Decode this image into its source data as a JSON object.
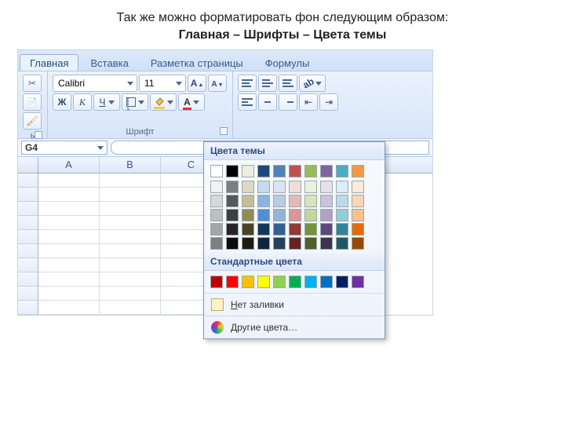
{
  "caption": {
    "line1": "Так же можно форматировать фон следующим образом:",
    "bold_part": "Главная – Шрифты – Цвета темы"
  },
  "tabs": [
    "Главная",
    "Вставка",
    "Разметка страницы",
    "Формулы"
  ],
  "active_tab_index": 0,
  "clipboard_partial_label": "ь",
  "font_group": {
    "label": "Шрифт",
    "font_name": "Calibri",
    "font_size": "11",
    "bold": "Ж",
    "italic": "К",
    "underline": "Ч"
  },
  "namebox": "G4",
  "column_headers": [
    "A",
    "B",
    "C"
  ],
  "grid_rows": 10,
  "picker": {
    "theme_header": "Цвета темы",
    "theme_row_main": [
      "#ffffff",
      "#000000",
      "#eeece1",
      "#1f497d",
      "#4f81bd",
      "#c0504d",
      "#9bbb59",
      "#8064a2",
      "#4bacc6",
      "#f79646"
    ],
    "theme_shades": [
      [
        "#f2f2f2",
        "#7f7f7f",
        "#ddd9c3",
        "#c6d9f0",
        "#dbe5f1",
        "#f2dcdb",
        "#ebf1dd",
        "#e5e0ec",
        "#dbeef3",
        "#fdeada"
      ],
      [
        "#d8d8d8",
        "#595959",
        "#c4bd97",
        "#8db3e2",
        "#b8cce4",
        "#e5b9b7",
        "#d7e3bc",
        "#ccc1d9",
        "#b7dde8",
        "#fbd5b5"
      ],
      [
        "#bfbfbf",
        "#3f3f3f",
        "#938953",
        "#548dd4",
        "#95b3d7",
        "#d99694",
        "#c3d69b",
        "#b2a2c7",
        "#92cddc",
        "#fac08f"
      ],
      [
        "#a5a5a5",
        "#262626",
        "#494429",
        "#17365d",
        "#366092",
        "#953734",
        "#76923c",
        "#5f497a",
        "#31859b",
        "#e36c09"
      ],
      [
        "#7f7f7f",
        "#0c0c0c",
        "#1d1b10",
        "#0f243e",
        "#244061",
        "#632423",
        "#4f6128",
        "#3f3151",
        "#205867",
        "#974806"
      ]
    ],
    "standard_header": "Стандартные цвета",
    "standard_colors": [
      "#c00000",
      "#ff0000",
      "#ffc000",
      "#ffff00",
      "#92d050",
      "#00b050",
      "#00b0f0",
      "#0070c0",
      "#002060",
      "#7030a0"
    ],
    "no_fill_label": "Нет заливки",
    "no_fill_underline_char": "Н",
    "more_colors_label": "Другие цвета…",
    "more_colors_underline_char": "Д"
  }
}
